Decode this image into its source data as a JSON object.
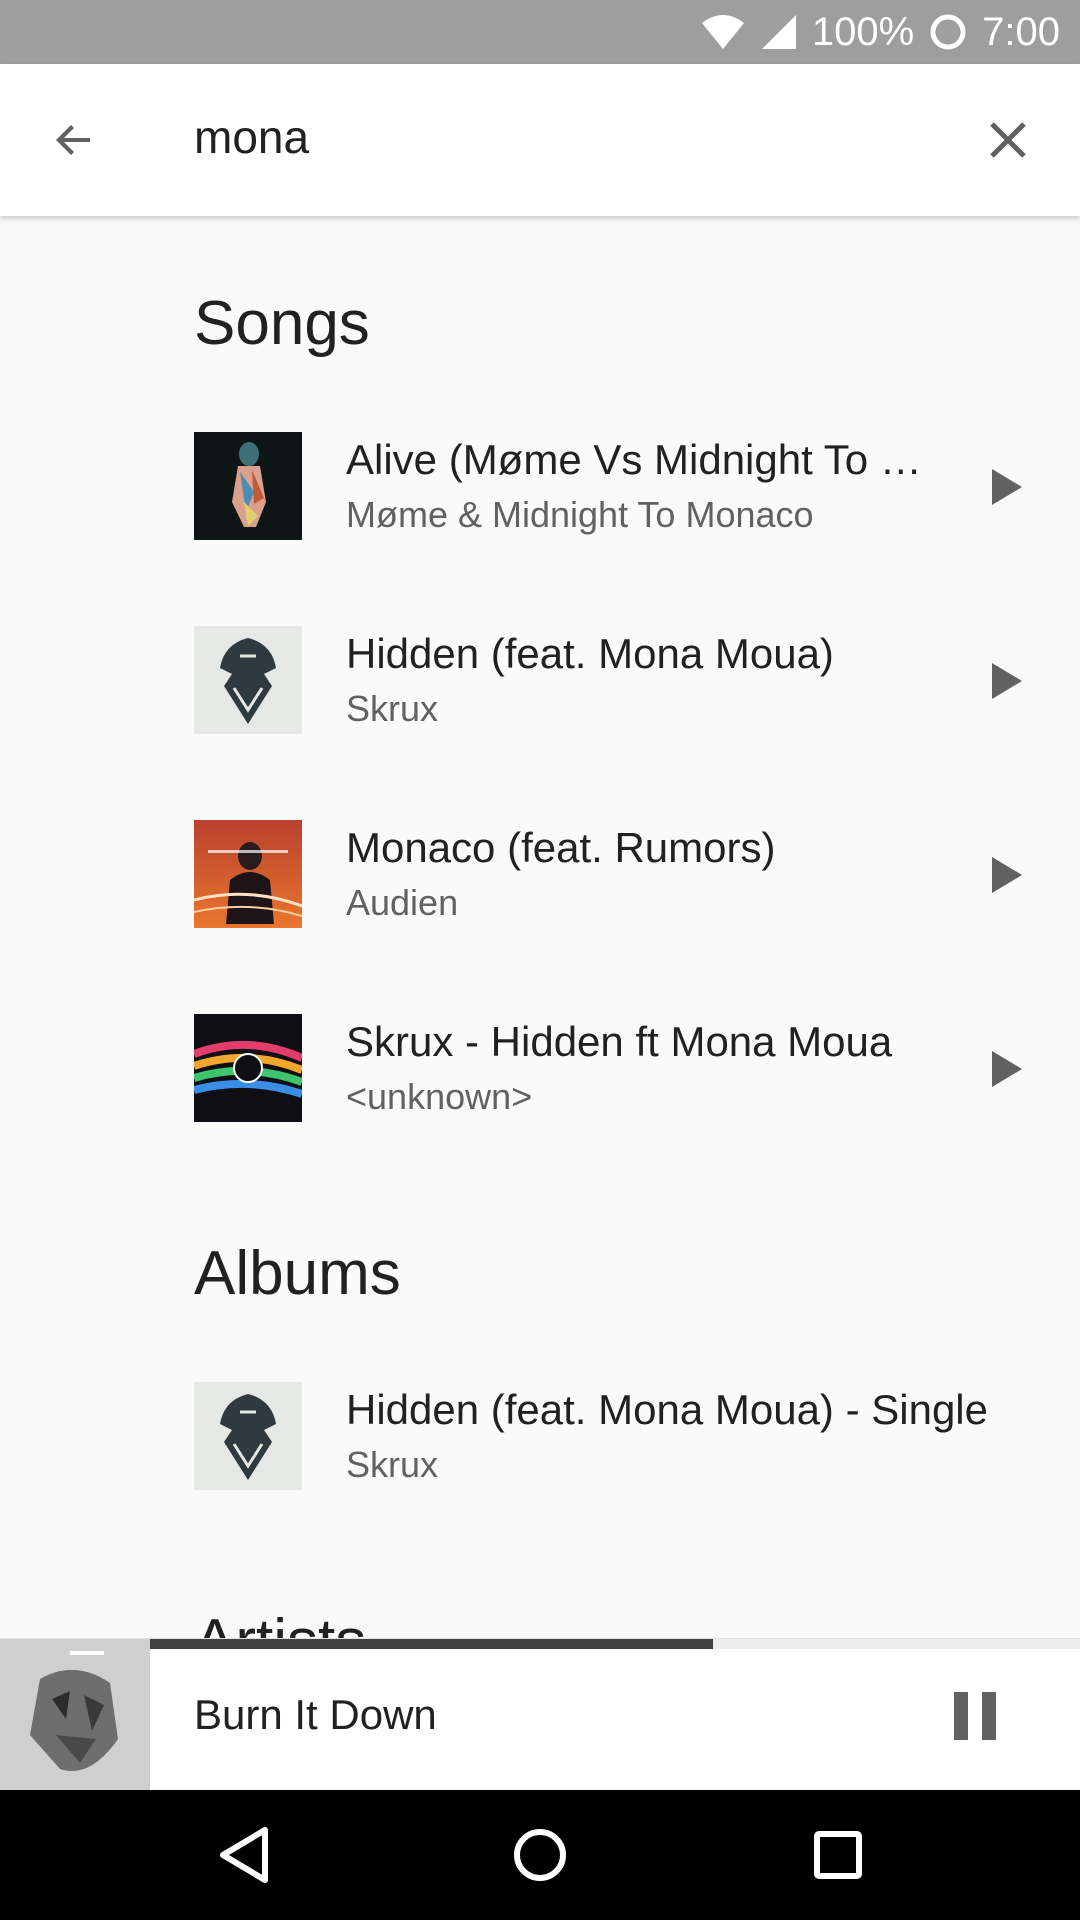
{
  "status_bar": {
    "battery_percent": "100%",
    "time": "7:00",
    "icons": [
      "wifi-icon",
      "cell-signal-icon",
      "battery-icon"
    ]
  },
  "search": {
    "query": "mona",
    "back_icon": "arrow-back-icon",
    "clear_icon": "close-icon"
  },
  "sections": {
    "songs": {
      "title": "Songs",
      "items": [
        {
          "title": "Alive (Møme Vs Midnight To Monaco)",
          "subtitle": "Møme & Midnight To Monaco"
        },
        {
          "title": "Hidden (feat. Mona Moua)",
          "subtitle": "Skrux"
        },
        {
          "title": "Monaco (feat. Rumors)",
          "subtitle": "Audien"
        },
        {
          "title": "Skrux - Hidden ft Mona Moua",
          "subtitle": "<unknown>"
        }
      ]
    },
    "albums": {
      "title": "Albums",
      "items": [
        {
          "title": "Hidden (feat. Mona Moua) - Single",
          "subtitle": "Skrux"
        }
      ]
    },
    "artists": {
      "title": "Artists"
    }
  },
  "now_playing": {
    "title": "Burn It Down",
    "progress": 0.605,
    "control_icon": "pause-icon"
  },
  "nav": {
    "icons": [
      "back-triangle-icon",
      "home-circle-icon",
      "recents-square-icon"
    ]
  },
  "colors": {
    "status_bar": "#9e9e9e",
    "background": "#fafafa",
    "progress": "#424242",
    "icon": "#616161"
  }
}
